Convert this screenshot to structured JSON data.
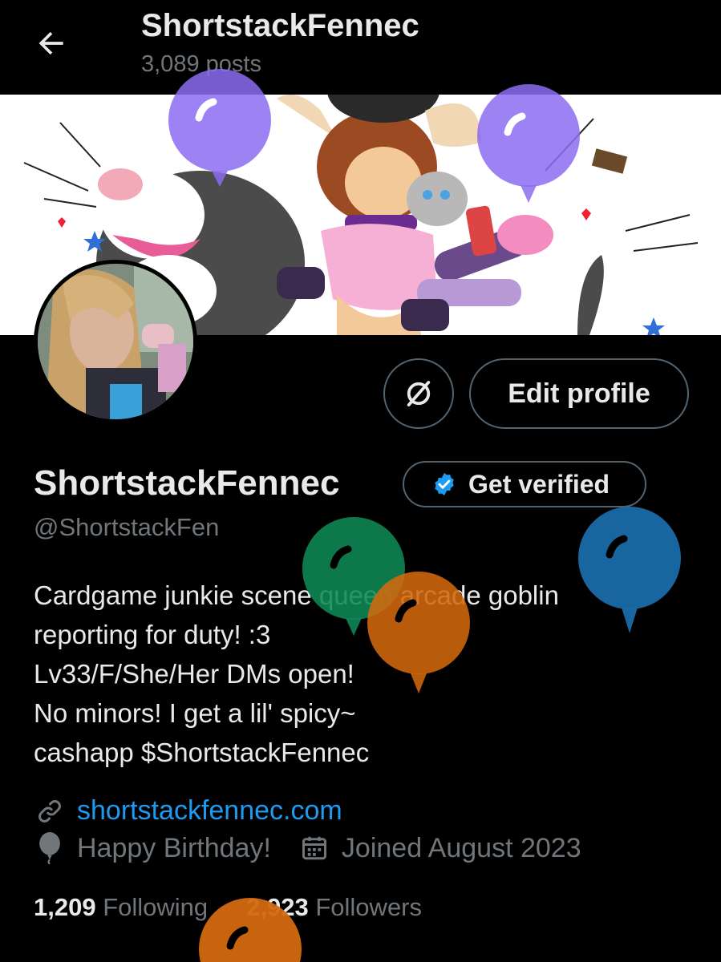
{
  "header": {
    "title": "ShortstackFennec",
    "posts": "3,089 posts"
  },
  "profile": {
    "display_name": "ShortstackFennec",
    "handle": "@ShortstackFen",
    "edit_label": "Edit profile",
    "verify_label": "Get verified",
    "bio": [
      "Cardgame junkie scene queen arcade goblin",
      "reporting for duty! :3",
      "Lv33/F/She/Her DMs open!",
      "No minors! I get a lil' spicy~",
      "cashapp $ShortstackFennec"
    ],
    "website": "shortstackfennec.com",
    "birthday": "Happy Birthday!",
    "joined": "Joined August 2023"
  },
  "stats": {
    "following_count": "1,209",
    "following_label": "Following",
    "followers_count": "2,923",
    "followers_label": "Followers"
  },
  "colors": {
    "background": "#000000",
    "text": "#e7e9ea",
    "muted": "#71767b",
    "link": "#1d9bf0",
    "border": "#536471",
    "balloon_purple": "#8b6cf0",
    "balloon_green": "#0f8a55",
    "balloon_orange": "#d2690e",
    "balloon_blue": "#1a6aa8"
  },
  "icons": [
    "back-arrow-icon",
    "no-grok-icon",
    "verified-badge-icon",
    "link-icon",
    "balloon-icon",
    "calendar-icon",
    "birthday-balloon-icon"
  ]
}
